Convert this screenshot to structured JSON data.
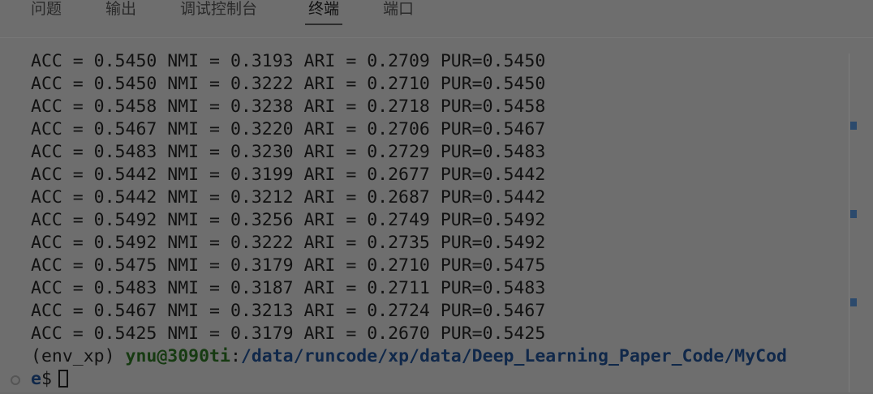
{
  "panel": {
    "tabs": [
      "问题",
      "输出",
      "调试控制台",
      "终端",
      "端口"
    ],
    "active_tab": "终端"
  },
  "terminal": {
    "lines": [
      "ACC = 0.5450 NMI = 0.3193 ARI = 0.2709 PUR=0.5450",
      "ACC = 0.5450 NMI = 0.3222 ARI = 0.2710 PUR=0.5450",
      "ACC = 0.5458 NMI = 0.3238 ARI = 0.2718 PUR=0.5458",
      "ACC = 0.5467 NMI = 0.3220 ARI = 0.2706 PUR=0.5467",
      "ACC = 0.5483 NMI = 0.3230 ARI = 0.2729 PUR=0.5483",
      "ACC = 0.5442 NMI = 0.3199 ARI = 0.2677 PUR=0.5442",
      "ACC = 0.5442 NMI = 0.3212 ARI = 0.2687 PUR=0.5442",
      "ACC = 0.5492 NMI = 0.3256 ARI = 0.2749 PUR=0.5492",
      "ACC = 0.5492 NMI = 0.3222 ARI = 0.2735 PUR=0.5492",
      "ACC = 0.5475 NMI = 0.3179 ARI = 0.2710 PUR=0.5475",
      "ACC = 0.5483 NMI = 0.3187 ARI = 0.2711 PUR=0.5483",
      "ACC = 0.5467 NMI = 0.3213 ARI = 0.2724 PUR=0.5467",
      "ACC = 0.5425 NMI = 0.3179 ARI = 0.2670 PUR=0.5425"
    ],
    "prompt": {
      "env": "(env_xp) ",
      "user_host": "ynu@3090ti",
      "colon": ":",
      "path_line1": "/data/runcode/xp/data/Deep_Learning_Paper_Code/MyCod",
      "path_line2": "e",
      "dollar": "$"
    }
  },
  "icons": {
    "status": "circle-outline-icon"
  },
  "colors": {
    "background": "#6e6e6e",
    "user_host": "#163a11",
    "path": "#10284a",
    "scroll_marker": "#2c4a6c"
  }
}
